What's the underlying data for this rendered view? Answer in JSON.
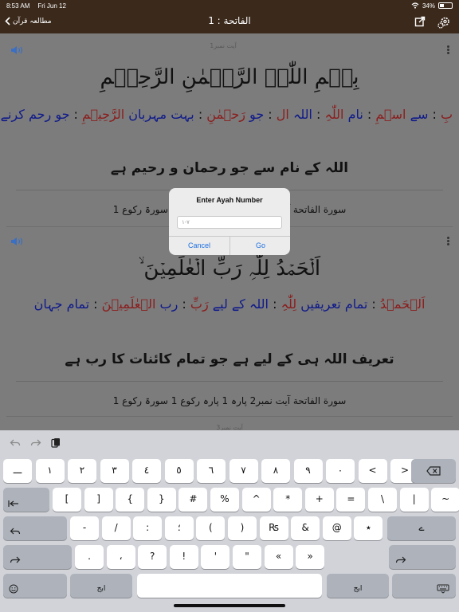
{
  "status": {
    "time": "8:53 AM",
    "date": "Fri Jun 12",
    "battery": "34%",
    "battery_level": 0.34
  },
  "nav": {
    "back_label": "مطالعہ قرآن",
    "title": "الفاتحة : 1"
  },
  "ayahs": [
    {
      "label": "آیت نمبر1",
      "arabic": "بِسۡمِ اللّٰہِ الرَّحۡمٰنِ الرَّحِیۡمِ",
      "words": [
        {
          "ar": "بِ",
          "ur": "سے"
        },
        {
          "ar": "اسۡمِ",
          "ur": "نام"
        },
        {
          "ar": "اللّٰہِ",
          "ur": "اللہ"
        },
        {
          "ar": "ال",
          "ur": "جو"
        },
        {
          "ar": "رَحۡمٰنِ",
          "ur": "بہت مہربان"
        },
        {
          "ar": "الرَّحِیۡمِ",
          "ur": "جو رحم کرنے والا"
        }
      ],
      "translation": "اللہ کے نام سے جو رحمان و رحیم ہے",
      "reference": "سورة الفاتحة آیت نمبر1 پارہ 1 پارہ رکوع 1 سورۃ رکوع 1"
    },
    {
      "label": "",
      "arabic": "اَلۡحَمۡدُ لِلّٰہِ رَبِّ الۡعٰلَمِیۡنَ ۙ",
      "words": [
        {
          "ar": "اَلۡحَمۡدُ",
          "ur": "تمام تعریفیں"
        },
        {
          "ar": "لِلّٰہِ",
          "ur": "اللہ کے لیے"
        },
        {
          "ar": "رَبِّ",
          "ur": "رب"
        },
        {
          "ar": "الۡعٰلَمِیۡنَ",
          "ur": "تمام جہان"
        }
      ],
      "translation": "تعریف اللہ ہی کے لیے ہے جو تمام کائنات کا رب ہے",
      "reference": "سورة الفاتحة آیت نمبر2 پارہ 1 پارہ رکوع 1 سورۃ رکوع 1"
    },
    {
      "label": "آیت نمبر3"
    }
  ],
  "alert": {
    "title": "Enter Ayah Number",
    "placeholder": "۱-۷",
    "cancel": "Cancel",
    "go": "Go"
  },
  "keyboard": {
    "rows": [
      [
        {
          "t": "",
          "m": "ـــ"
        },
        {
          "t": "",
          "m": "١"
        },
        {
          "t": "",
          "m": "٢"
        },
        {
          "t": "",
          "m": "٣"
        },
        {
          "t": "",
          "m": "٤"
        },
        {
          "t": "",
          "m": "٥"
        },
        {
          "t": "",
          "m": "٦"
        },
        {
          "t": "",
          "m": "٧"
        },
        {
          "t": "",
          "m": "٨"
        },
        {
          "t": "",
          "m": "٩"
        },
        {
          "t": "",
          "m": "٠"
        },
        {
          "t": "",
          "m": "<"
        },
        {
          "t": "",
          "m": ">"
        }
      ],
      [
        {
          "m": "["
        },
        {
          "m": "]"
        },
        {
          "m": "{"
        },
        {
          "m": "}"
        },
        {
          "m": "#"
        },
        {
          "m": "%"
        },
        {
          "m": "^"
        },
        {
          "m": "*"
        },
        {
          "m": "+"
        },
        {
          "m": "="
        },
        {
          "m": "\\"
        },
        {
          "m": "|"
        },
        {
          "m": "~"
        }
      ],
      [
        {
          "m": "-"
        },
        {
          "m": "/"
        },
        {
          "m": ":"
        },
        {
          "m": "؛"
        },
        {
          "m": "("
        },
        {
          "m": ")"
        },
        {
          "m": "₨"
        },
        {
          "m": "&"
        },
        {
          "m": "@"
        },
        {
          "m": "٭"
        }
      ],
      [
        {
          "m": "."
        },
        {
          "m": "،"
        },
        {
          "m": "?"
        },
        {
          "m": "!"
        },
        {
          "m": "'"
        },
        {
          "m": "\""
        },
        {
          "m": "«"
        },
        {
          "m": "»"
        }
      ]
    ],
    "abc_left": "ابج",
    "abc_right": "ابج",
    "return_label": "ے"
  }
}
